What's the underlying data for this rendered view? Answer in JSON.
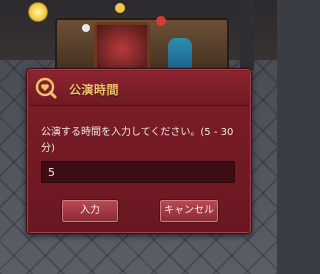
{
  "dialog": {
    "title": "公演時間",
    "icon": "heart-search-icon",
    "prompt": "公演する時間を入力してください。(5 - 30 分)",
    "input_value": "5",
    "ok_label": "入力",
    "cancel_label": "キャンセル"
  },
  "colors": {
    "dialog_bg": "#7d1e28",
    "title_text": "#f0c26a",
    "button_bg": "#b84a55"
  }
}
